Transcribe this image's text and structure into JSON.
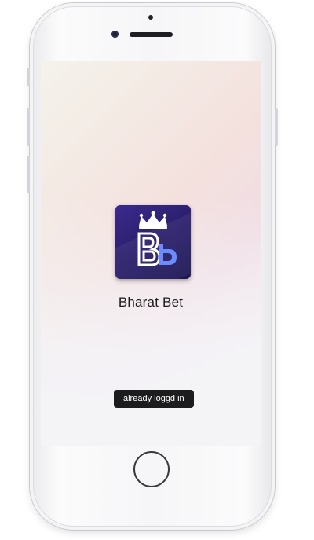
{
  "app": {
    "name": "Bharat Bet",
    "icon": "bharat-bet-logo-icon",
    "icon_colors": {
      "bg_start": "#3b2a8e",
      "bg_end": "#1d1654",
      "b_left": "#ffffff",
      "b_right": "#6a8cff"
    }
  },
  "toast": {
    "message": "already loggd in"
  },
  "device": {
    "type": "iphone-mockup",
    "frame_color": "#f4f4f6"
  }
}
